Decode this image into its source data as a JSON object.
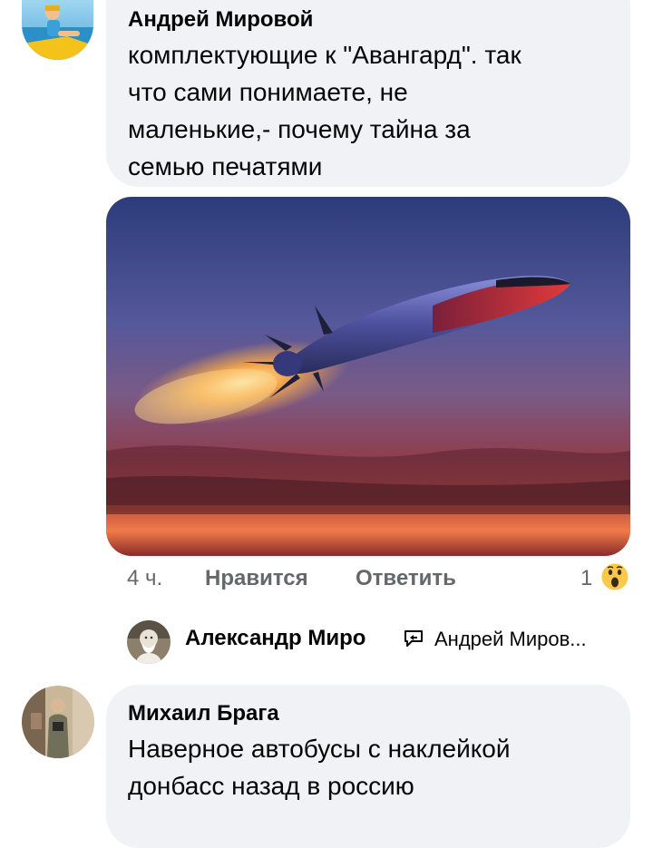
{
  "comments": [
    {
      "author": "Андрей Мировой",
      "lines": [
        "комплектующие к \"Авангард\". так",
        "что сами понимаете, не",
        "маленькие,- почему тайна за",
        "семью печатями"
      ]
    },
    {
      "author": "Михаил Брага",
      "lines": [
        "Наверное автобусы с наклейкой",
        "донбасс назад в россию"
      ]
    }
  ],
  "actions": {
    "time": "4 ч.",
    "like": "Нравится",
    "reply": "Ответить",
    "reaction_count": "1",
    "reaction_icon": "wow-emoji-icon"
  },
  "reply_preview": {
    "author": "Александр Миро",
    "reply_icon": "reply-arrow-icon",
    "to": "Андрей Миров..."
  },
  "colors": {
    "bubble": "#f0f2f5",
    "meta_gray": "#65676b"
  }
}
